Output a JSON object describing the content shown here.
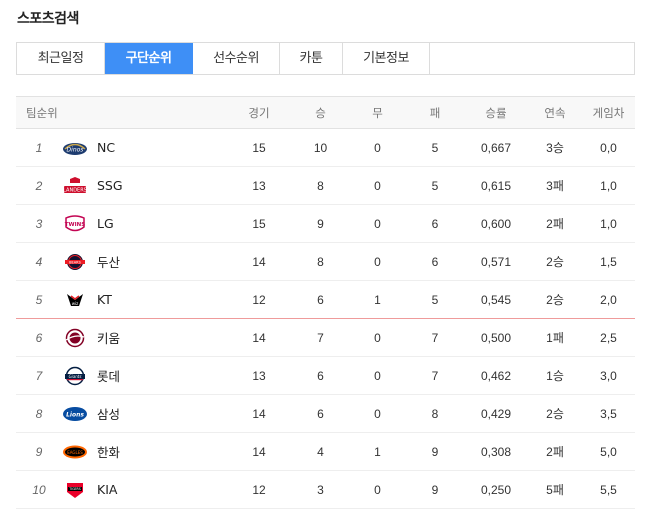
{
  "section_title": "스포츠검색",
  "tabs": [
    {
      "label": "최근일정",
      "active": false
    },
    {
      "label": "구단순위",
      "active": true
    },
    {
      "label": "선수순위",
      "active": false
    },
    {
      "label": "카툰",
      "active": false
    },
    {
      "label": "기본정보",
      "active": false
    }
  ],
  "colors": {
    "accent": "#3e8ff6",
    "games_behind": "#c0143c",
    "cutline": "#ef9b9b"
  },
  "table": {
    "headers": {
      "team": "팀순위",
      "games": "경기",
      "wins": "승",
      "draws": "무",
      "losses": "패",
      "pct": "승률",
      "streak": "연속",
      "gb": "게임차"
    },
    "rows": [
      {
        "rank": "1",
        "team": "NC",
        "logo": "nc-dinos-logo",
        "games": "15",
        "wins": "10",
        "draws": "0",
        "losses": "5",
        "pct": "0,667",
        "streak": "3승",
        "gb": "0,0"
      },
      {
        "rank": "2",
        "team": "SSG",
        "logo": "ssg-landers-logo",
        "games": "13",
        "wins": "8",
        "draws": "0",
        "losses": "5",
        "pct": "0,615",
        "streak": "3패",
        "gb": "1,0"
      },
      {
        "rank": "3",
        "team": "LG",
        "logo": "lg-twins-logo",
        "games": "15",
        "wins": "9",
        "draws": "0",
        "losses": "6",
        "pct": "0,600",
        "streak": "2패",
        "gb": "1,0"
      },
      {
        "rank": "4",
        "team": "두산",
        "logo": "doosan-bears-logo",
        "games": "14",
        "wins": "8",
        "draws": "0",
        "losses": "6",
        "pct": "0,571",
        "streak": "2승",
        "gb": "1,5"
      },
      {
        "rank": "5",
        "team": "KT",
        "logo": "kt-wiz-logo",
        "games": "12",
        "wins": "6",
        "draws": "1",
        "losses": "5",
        "pct": "0,545",
        "streak": "2승",
        "gb": "2,0"
      },
      {
        "rank": "6",
        "team": "키움",
        "logo": "kiwoom-heroes-logo",
        "games": "14",
        "wins": "7",
        "draws": "0",
        "losses": "7",
        "pct": "0,500",
        "streak": "1패",
        "gb": "2,5"
      },
      {
        "rank": "7",
        "team": "롯데",
        "logo": "lotte-giants-logo",
        "games": "13",
        "wins": "6",
        "draws": "0",
        "losses": "7",
        "pct": "0,462",
        "streak": "1승",
        "gb": "3,0"
      },
      {
        "rank": "8",
        "team": "삼성",
        "logo": "samsung-lions-logo",
        "games": "14",
        "wins": "6",
        "draws": "0",
        "losses": "8",
        "pct": "0,429",
        "streak": "2승",
        "gb": "3,5"
      },
      {
        "rank": "9",
        "team": "한화",
        "logo": "hanwha-eagles-logo",
        "games": "14",
        "wins": "4",
        "draws": "1",
        "losses": "9",
        "pct": "0,308",
        "streak": "2패",
        "gb": "5,0"
      },
      {
        "rank": "10",
        "team": "KIA",
        "logo": "kia-tigers-logo",
        "games": "12",
        "wins": "3",
        "draws": "0",
        "losses": "9",
        "pct": "0,250",
        "streak": "5패",
        "gb": "5,5"
      }
    ]
  }
}
